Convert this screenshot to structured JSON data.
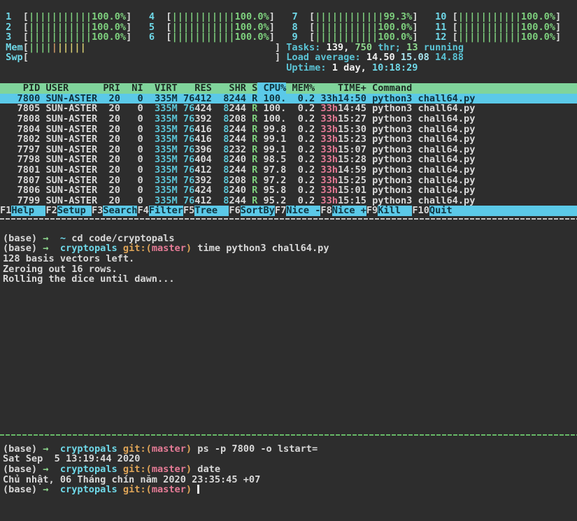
{
  "colors": {
    "background": "#2d2d2d",
    "header_green": "#80d49b",
    "selection_cyan": "#5bc9e8",
    "text_cyan": "#5bc4d6",
    "text_green": "#7ed07e",
    "text_pink": "#e57b96",
    "text_gold": "#dfa558",
    "mem_bar_orange": "#cc9966",
    "mem_bar_yellow": "#d9cf72"
  },
  "htop": {
    "meter_rows": [
      [
        "1",
        "4",
        "7",
        "10"
      ],
      [
        "2",
        "5",
        "8",
        "11"
      ],
      [
        "3",
        "6",
        "9",
        "12"
      ]
    ],
    "cpu_meters": {
      "1": "100.0%",
      "2": "100.0%",
      "3": "100.0%",
      "4": "100.0%",
      "5": "100.0%",
      "6": "100.0%",
      "7": "99.3%",
      "8": "100.0%",
      "9": "100.0%",
      "10": "100.0%",
      "11": "100.0%",
      "12": "100.0%"
    },
    "mem_meter": {
      "label": "Mem",
      "bars": [
        {
          "c": "gr",
          "n": 4
        },
        {
          "c": "orange",
          "n": 1
        },
        {
          "c": "yellow",
          "n": 5
        }
      ]
    },
    "swp_meter": {
      "label": "Swp",
      "bars": []
    },
    "tasks": [
      {
        "t": "Tasks: ",
        "c": "cy"
      },
      {
        "t": "139,",
        "c": "wb"
      },
      {
        "t": " ",
        "c": "cy"
      },
      {
        "t": "750",
        "c": "grb"
      },
      {
        "t": " thr; ",
        "c": "cy"
      },
      {
        "t": "13",
        "c": "grb"
      },
      {
        "t": " running",
        "c": "cy"
      }
    ],
    "load_average": [
      {
        "t": "Load average: ",
        "c": "cy"
      },
      {
        "t": "14.50",
        "c": "wb"
      },
      {
        "t": " ",
        "c": "cy"
      },
      {
        "t": "15.08",
        "c": "cybr"
      },
      {
        "t": " ",
        "c": "cy"
      },
      {
        "t": "14.88",
        "c": "cy"
      }
    ],
    "uptime": [
      {
        "t": "Uptime: ",
        "c": "cy"
      },
      {
        "t": "1 day, ",
        "c": "wb"
      },
      {
        "t": "10:18:29",
        "c": "cyb"
      }
    ],
    "table": {
      "columns": [
        "PID",
        "USER",
        "PRI",
        "NI",
        "VIRT",
        "RES",
        "SHR",
        "S",
        "CPU%",
        "MEM%",
        "TIME+",
        "Command"
      ],
      "sort_column": "CPU%",
      "rows": [
        {
          "pid": "7800",
          "user": "SUN-ASTER",
          "pri": "20",
          "ni": "0",
          "virt": "335M",
          "res": [
            "76",
            "412"
          ],
          "shr": [
            "8",
            "244"
          ],
          "s": "R",
          "cpu": "100.",
          "mem": "0.2",
          "time": [
            "33h",
            "14:50"
          ],
          "cmd": "python3 chall64.py",
          "selected": true
        },
        {
          "pid": "7805",
          "user": "SUN-ASTER",
          "pri": "20",
          "ni": "0",
          "virt": "335M",
          "res": [
            "76",
            "424"
          ],
          "shr": [
            "8",
            "244"
          ],
          "s": "R",
          "cpu": "100.",
          "mem": "0.2",
          "time": [
            "33h",
            "14:45"
          ],
          "cmd": "python3 chall64.py",
          "selected": false
        },
        {
          "pid": "7808",
          "user": "SUN-ASTER",
          "pri": "20",
          "ni": "0",
          "virt": "335M",
          "res": [
            "76",
            "392"
          ],
          "shr": [
            "8",
            "208"
          ],
          "s": "R",
          "cpu": "100.",
          "mem": "0.2",
          "time": [
            "33h",
            "15:27"
          ],
          "cmd": "python3 chall64.py",
          "selected": false
        },
        {
          "pid": "7804",
          "user": "SUN-ASTER",
          "pri": "20",
          "ni": "0",
          "virt": "335M",
          "res": [
            "76",
            "416"
          ],
          "shr": [
            "8",
            "244"
          ],
          "s": "R",
          "cpu": "99.8",
          "mem": "0.2",
          "time": [
            "33h",
            "15:30"
          ],
          "cmd": "python3 chall64.py",
          "selected": false
        },
        {
          "pid": "7802",
          "user": "SUN-ASTER",
          "pri": "20",
          "ni": "0",
          "virt": "335M",
          "res": [
            "76",
            "416"
          ],
          "shr": [
            "8",
            "244"
          ],
          "s": "R",
          "cpu": "99.1",
          "mem": "0.2",
          "time": [
            "33h",
            "15:23"
          ],
          "cmd": "python3 chall64.py",
          "selected": false
        },
        {
          "pid": "7797",
          "user": "SUN-ASTER",
          "pri": "20",
          "ni": "0",
          "virt": "335M",
          "res": [
            "76",
            "396"
          ],
          "shr": [
            "8",
            "232"
          ],
          "s": "R",
          "cpu": "99.1",
          "mem": "0.2",
          "time": [
            "33h",
            "15:07"
          ],
          "cmd": "python3 chall64.py",
          "selected": false
        },
        {
          "pid": "7798",
          "user": "SUN-ASTER",
          "pri": "20",
          "ni": "0",
          "virt": "335M",
          "res": [
            "76",
            "404"
          ],
          "shr": [
            "8",
            "240"
          ],
          "s": "R",
          "cpu": "98.5",
          "mem": "0.2",
          "time": [
            "33h",
            "15:28"
          ],
          "cmd": "python3 chall64.py",
          "selected": false
        },
        {
          "pid": "7801",
          "user": "SUN-ASTER",
          "pri": "20",
          "ni": "0",
          "virt": "335M",
          "res": [
            "76",
            "412"
          ],
          "shr": [
            "8",
            "244"
          ],
          "s": "R",
          "cpu": "97.8",
          "mem": "0.2",
          "time": [
            "33h",
            "14:59"
          ],
          "cmd": "python3 chall64.py",
          "selected": false
        },
        {
          "pid": "7807",
          "user": "SUN-ASTER",
          "pri": "20",
          "ni": "0",
          "virt": "335M",
          "res": [
            "76",
            "392"
          ],
          "shr": [
            "8",
            "208"
          ],
          "s": "R",
          "cpu": "97.2",
          "mem": "0.2",
          "time": [
            "33h",
            "15:25"
          ],
          "cmd": "python3 chall64.py",
          "selected": false
        },
        {
          "pid": "7806",
          "user": "SUN-ASTER",
          "pri": "20",
          "ni": "0",
          "virt": "335M",
          "res": [
            "76",
            "424"
          ],
          "shr": [
            "8",
            "240"
          ],
          "s": "R",
          "cpu": "95.8",
          "mem": "0.2",
          "time": [
            "33h",
            "15:01"
          ],
          "cmd": "python3 chall64.py",
          "selected": false
        },
        {
          "pid": "7799",
          "user": "SUN-ASTER",
          "pri": "20",
          "ni": "0",
          "virt": "335M",
          "res": [
            "76",
            "412"
          ],
          "shr": [
            "8",
            "244"
          ],
          "s": "R",
          "cpu": "95.2",
          "mem": "0.2",
          "time": [
            "33h",
            "15:15"
          ],
          "cmd": "python3 chall64.py",
          "selected": false
        }
      ]
    },
    "fkeys": [
      {
        "key": "F1",
        "label": "Help"
      },
      {
        "key": "F2",
        "label": "Setup"
      },
      {
        "key": "F3",
        "label": "Search"
      },
      {
        "key": "F4",
        "label": "Filter"
      },
      {
        "key": "F5",
        "label": "Tree"
      },
      {
        "key": "F6",
        "label": "SortBy"
      },
      {
        "key": "F7",
        "label": "Nice -"
      },
      {
        "key": "F8",
        "label": "Nice +"
      },
      {
        "key": "F9",
        "label": "Kill"
      },
      {
        "key": "F10",
        "label": "Quit"
      }
    ]
  },
  "shell_top": {
    "lines": [
      {
        "segs": [
          {
            "t": "(base) ",
            "c": "w"
          },
          {
            "t": "→",
            "c": "grb"
          },
          {
            "t": "  ",
            "c": "w"
          },
          {
            "t": "~",
            "c": "cyb"
          },
          {
            "t": " cd code/cryptopals",
            "c": "w"
          }
        ],
        "cursor": false
      },
      {
        "segs": [
          {
            "t": "(base) ",
            "c": "w"
          },
          {
            "t": "→",
            "c": "grb"
          },
          {
            "t": "  ",
            "c": "w"
          },
          {
            "t": "cryptopals",
            "c": "cyb"
          },
          {
            "t": " ",
            "c": "w"
          },
          {
            "t": "git:(",
            "c": "gold"
          },
          {
            "t": "master",
            "c": "pink"
          },
          {
            "t": ")",
            "c": "gold"
          },
          {
            "t": " time python3 chall64.py",
            "c": "w"
          }
        ],
        "cursor": false
      },
      {
        "segs": [
          {
            "t": "128 basis vectors left.",
            "c": "w"
          }
        ],
        "cursor": false
      },
      {
        "segs": [
          {
            "t": "Zeroing out 16 rows.",
            "c": "w"
          }
        ],
        "cursor": false
      },
      {
        "segs": [
          {
            "t": "Rolling the dice until dawn...",
            "c": "w"
          }
        ],
        "cursor": false
      }
    ]
  },
  "shell_bottom": {
    "lines": [
      {
        "segs": [
          {
            "t": "(base) ",
            "c": "w"
          },
          {
            "t": "→",
            "c": "grb"
          },
          {
            "t": "  ",
            "c": "w"
          },
          {
            "t": "cryptopals",
            "c": "cyb"
          },
          {
            "t": " ",
            "c": "w"
          },
          {
            "t": "git:(",
            "c": "gold"
          },
          {
            "t": "master",
            "c": "pink"
          },
          {
            "t": ")",
            "c": "gold"
          },
          {
            "t": " ps -p 7800 -o lstart=",
            "c": "w"
          }
        ],
        "cursor": false
      },
      {
        "segs": [
          {
            "t": "Sat Sep  5 13:19:44 2020",
            "c": "w"
          }
        ],
        "cursor": false
      },
      {
        "segs": [
          {
            "t": "(base) ",
            "c": "w"
          },
          {
            "t": "→",
            "c": "grb"
          },
          {
            "t": "  ",
            "c": "w"
          },
          {
            "t": "cryptopals",
            "c": "cyb"
          },
          {
            "t": " ",
            "c": "w"
          },
          {
            "t": "git:(",
            "c": "gold"
          },
          {
            "t": "master",
            "c": "pink"
          },
          {
            "t": ")",
            "c": "gold"
          },
          {
            "t": " date",
            "c": "w"
          }
        ],
        "cursor": false
      },
      {
        "segs": [
          {
            "t": "Chủ nhật, 06 Tháng chín năm 2020 23:35:45 +07",
            "c": "w"
          }
        ],
        "cursor": false
      },
      {
        "segs": [
          {
            "t": "(base) ",
            "c": "w"
          },
          {
            "t": "→",
            "c": "grb"
          },
          {
            "t": "  ",
            "c": "w"
          },
          {
            "t": "cryptopals",
            "c": "cyb"
          },
          {
            "t": " ",
            "c": "w"
          },
          {
            "t": "git:(",
            "c": "gold"
          },
          {
            "t": "master",
            "c": "pink"
          },
          {
            "t": ")",
            "c": "gold"
          },
          {
            "t": " ",
            "c": "w"
          }
        ],
        "cursor": true
      }
    ]
  }
}
